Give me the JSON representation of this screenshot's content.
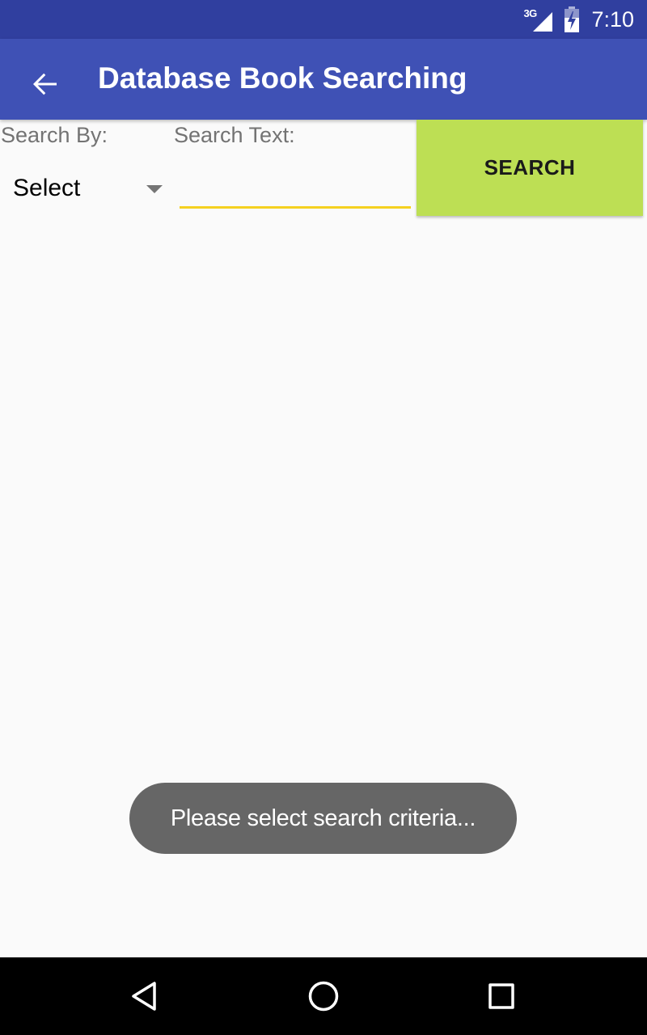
{
  "status_bar": {
    "network_type": "3G",
    "time": "7:10",
    "icons": [
      "signal-icon",
      "battery-charging-icon"
    ],
    "background_color": "#303f9f"
  },
  "app_bar": {
    "title": "Database Book Searching",
    "back_icon": "arrow-back-icon",
    "background_color": "#3f51b5"
  },
  "form": {
    "search_by_label": "Search By:",
    "search_by_selected": "Select",
    "search_text_label": "Search Text:",
    "search_text_value": "",
    "search_text_underline_color": "#f5d120",
    "search_button_label": "SEARCH",
    "search_button_color": "#bddf54"
  },
  "toast": {
    "message": "Please select search criteria..."
  },
  "nav_bar": {
    "buttons": [
      "back-triangle-icon",
      "home-circle-icon",
      "recents-square-icon"
    ]
  }
}
